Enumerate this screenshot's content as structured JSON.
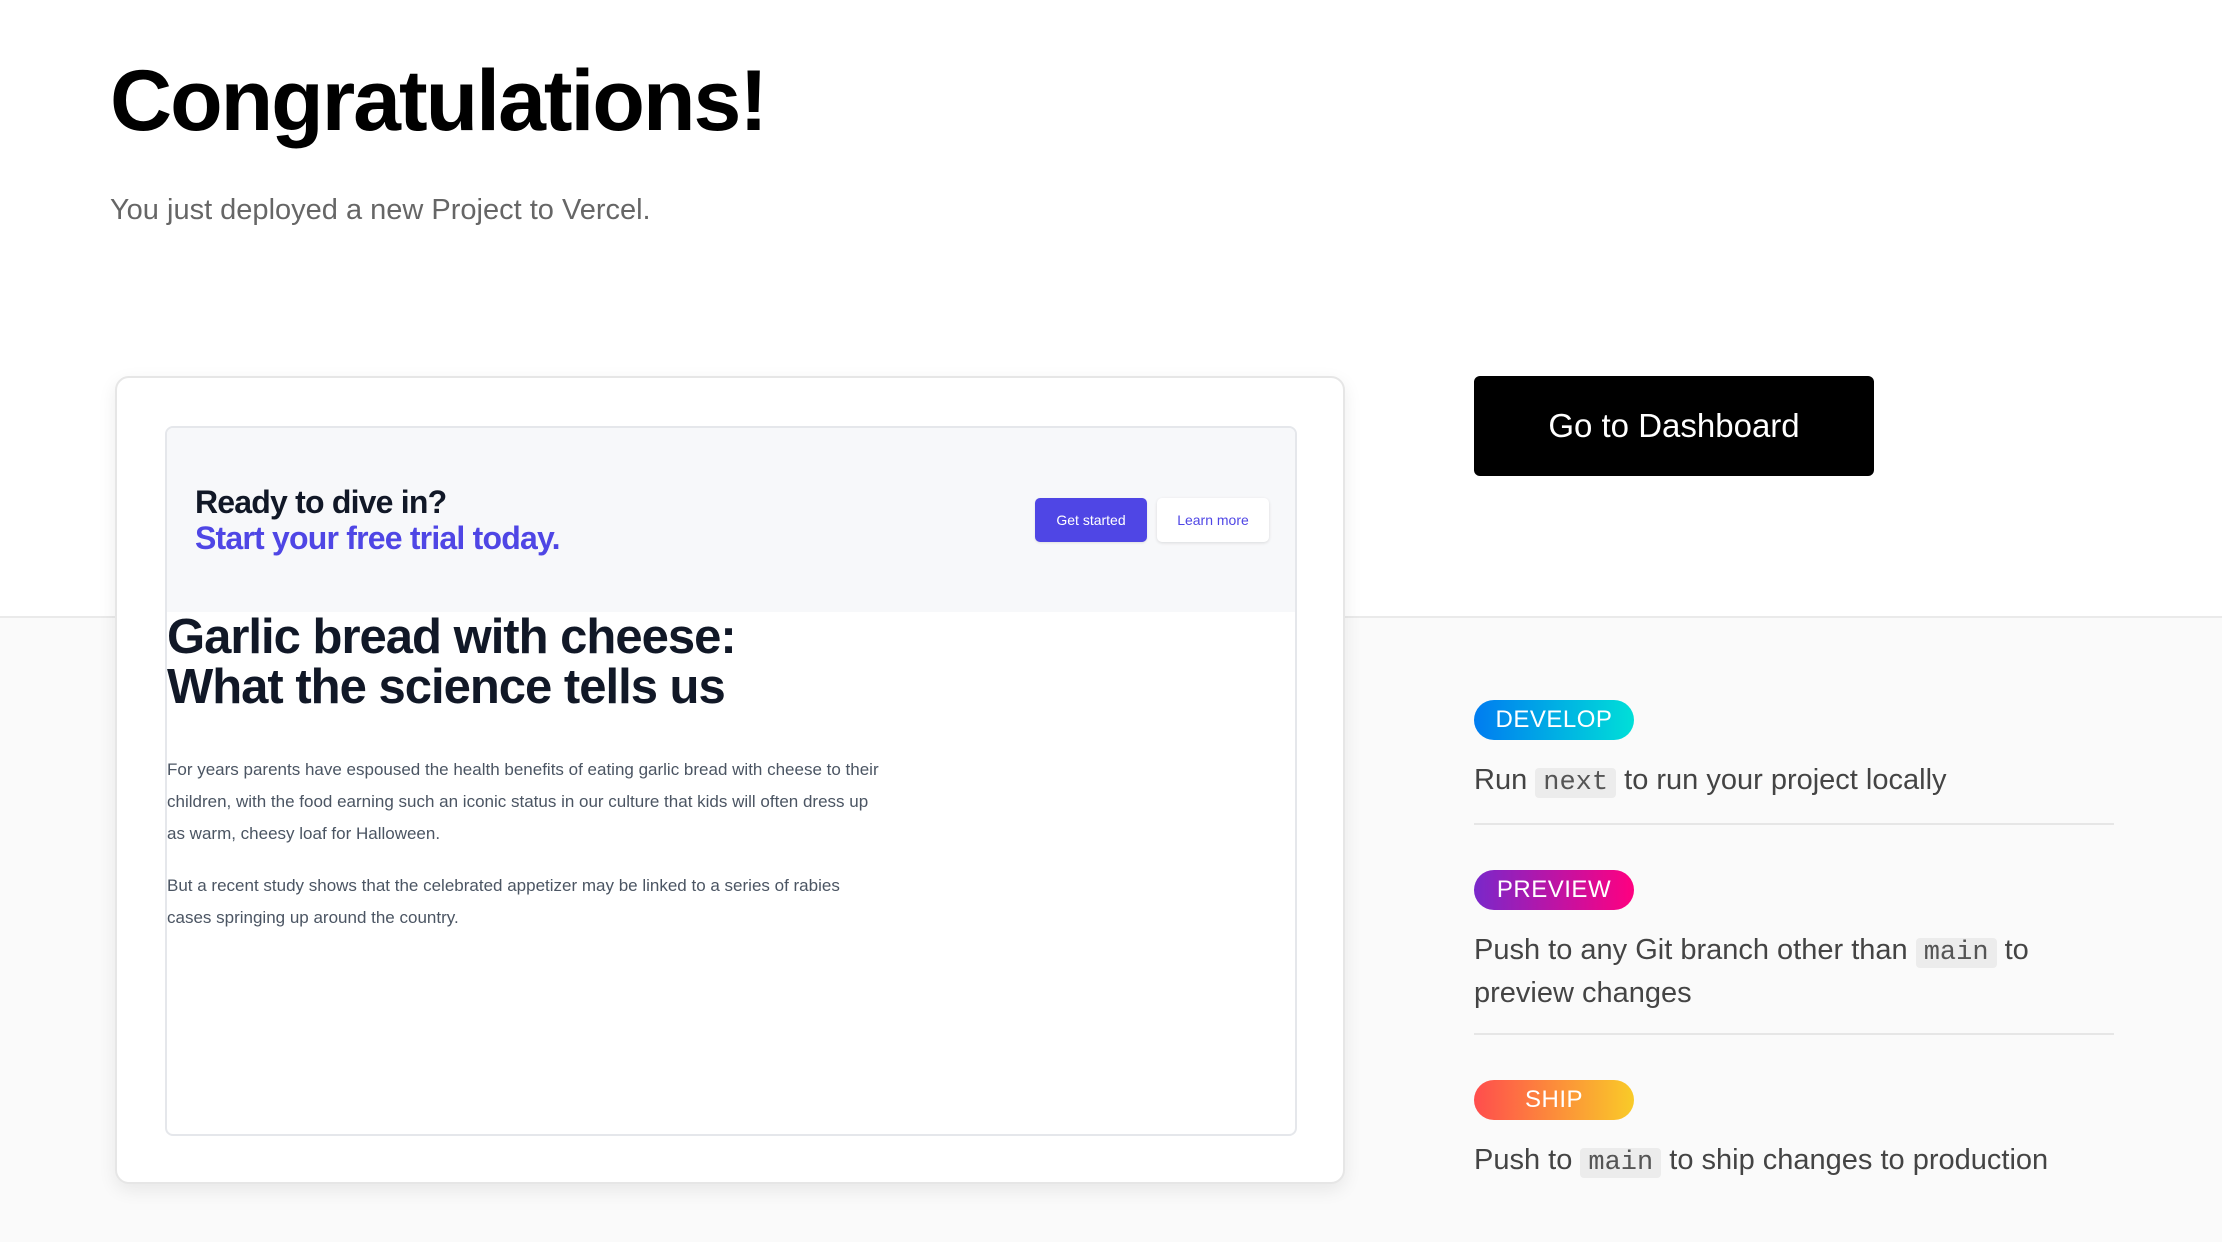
{
  "header": {
    "title": "Congratulations!",
    "subtitle": "You just deployed a new Project to Vercel."
  },
  "preview": {
    "banner": {
      "line1": "Ready to dive in?",
      "line2": "Start your free trial today.",
      "primary_button": "Get started",
      "secondary_button": "Learn more"
    },
    "article": {
      "title_line1": "Garlic bread with cheese:",
      "title_line2": "What the science tells us",
      "paragraph1": "For years parents have espoused the health benefits of eating garlic bread with cheese to their children, with the food earning such an iconic status in our culture that kids will often dress up as warm, cheesy loaf for Halloween.",
      "paragraph2": "But a recent study shows that the celebrated appetizer may be linked to a series of rabies cases springing up around the country."
    }
  },
  "dashboard_button": "Go to Dashboard",
  "steps": {
    "develop": {
      "badge": "DEVELOP",
      "text_before": "Run",
      "code": "next",
      "text_after": "to run your project locally"
    },
    "preview": {
      "badge": "PREVIEW",
      "text_before": "Push to any Git branch other than",
      "code": "main",
      "text_after": "to preview changes"
    },
    "ship": {
      "badge": "SHIP",
      "text_before": "Push to",
      "code": "main",
      "text_after": "to ship changes to production"
    }
  },
  "colors": {
    "primary_button": "#4f46e5",
    "dashboard_button": "#000000",
    "develop_gradient": [
      "#007cf0",
      "#00dfd8"
    ],
    "preview_gradient": [
      "#7928ca",
      "#ff0080"
    ],
    "ship_gradient": [
      "#ff4d4d",
      "#f9cb28"
    ]
  }
}
